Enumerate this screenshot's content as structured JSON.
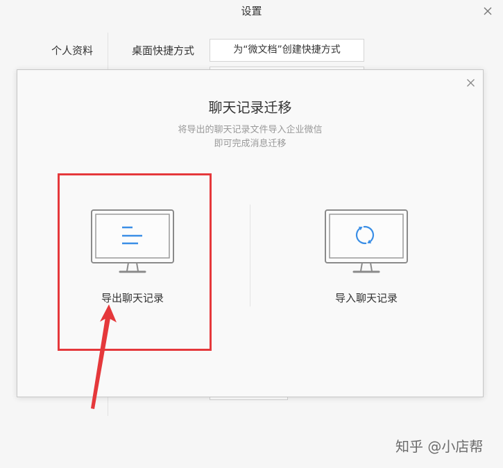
{
  "window": {
    "title": "设置",
    "close_icon": "close-icon"
  },
  "settings": {
    "nav": [
      {
        "label": "个人资料"
      }
    ],
    "rows": [
      {
        "label": "桌面快捷方式",
        "button_label": "为“微文档”创建快捷方式"
      }
    ]
  },
  "dialog": {
    "title": "聊天记录迁移",
    "subtitle_lines": [
      "将导出的聊天记录文件导入企业微信",
      "即可完成消息迁移"
    ],
    "close_icon": "close-icon",
    "options": [
      {
        "label": "导出聊天记录",
        "icon": "monitor-list-icon"
      },
      {
        "label": "导入聊天记录",
        "icon": "monitor-sync-icon"
      }
    ]
  },
  "watermark": {
    "text": "知乎 @小店帮"
  },
  "colors": {
    "accent": "#3a8ee6",
    "annotation": "#e5383b"
  }
}
